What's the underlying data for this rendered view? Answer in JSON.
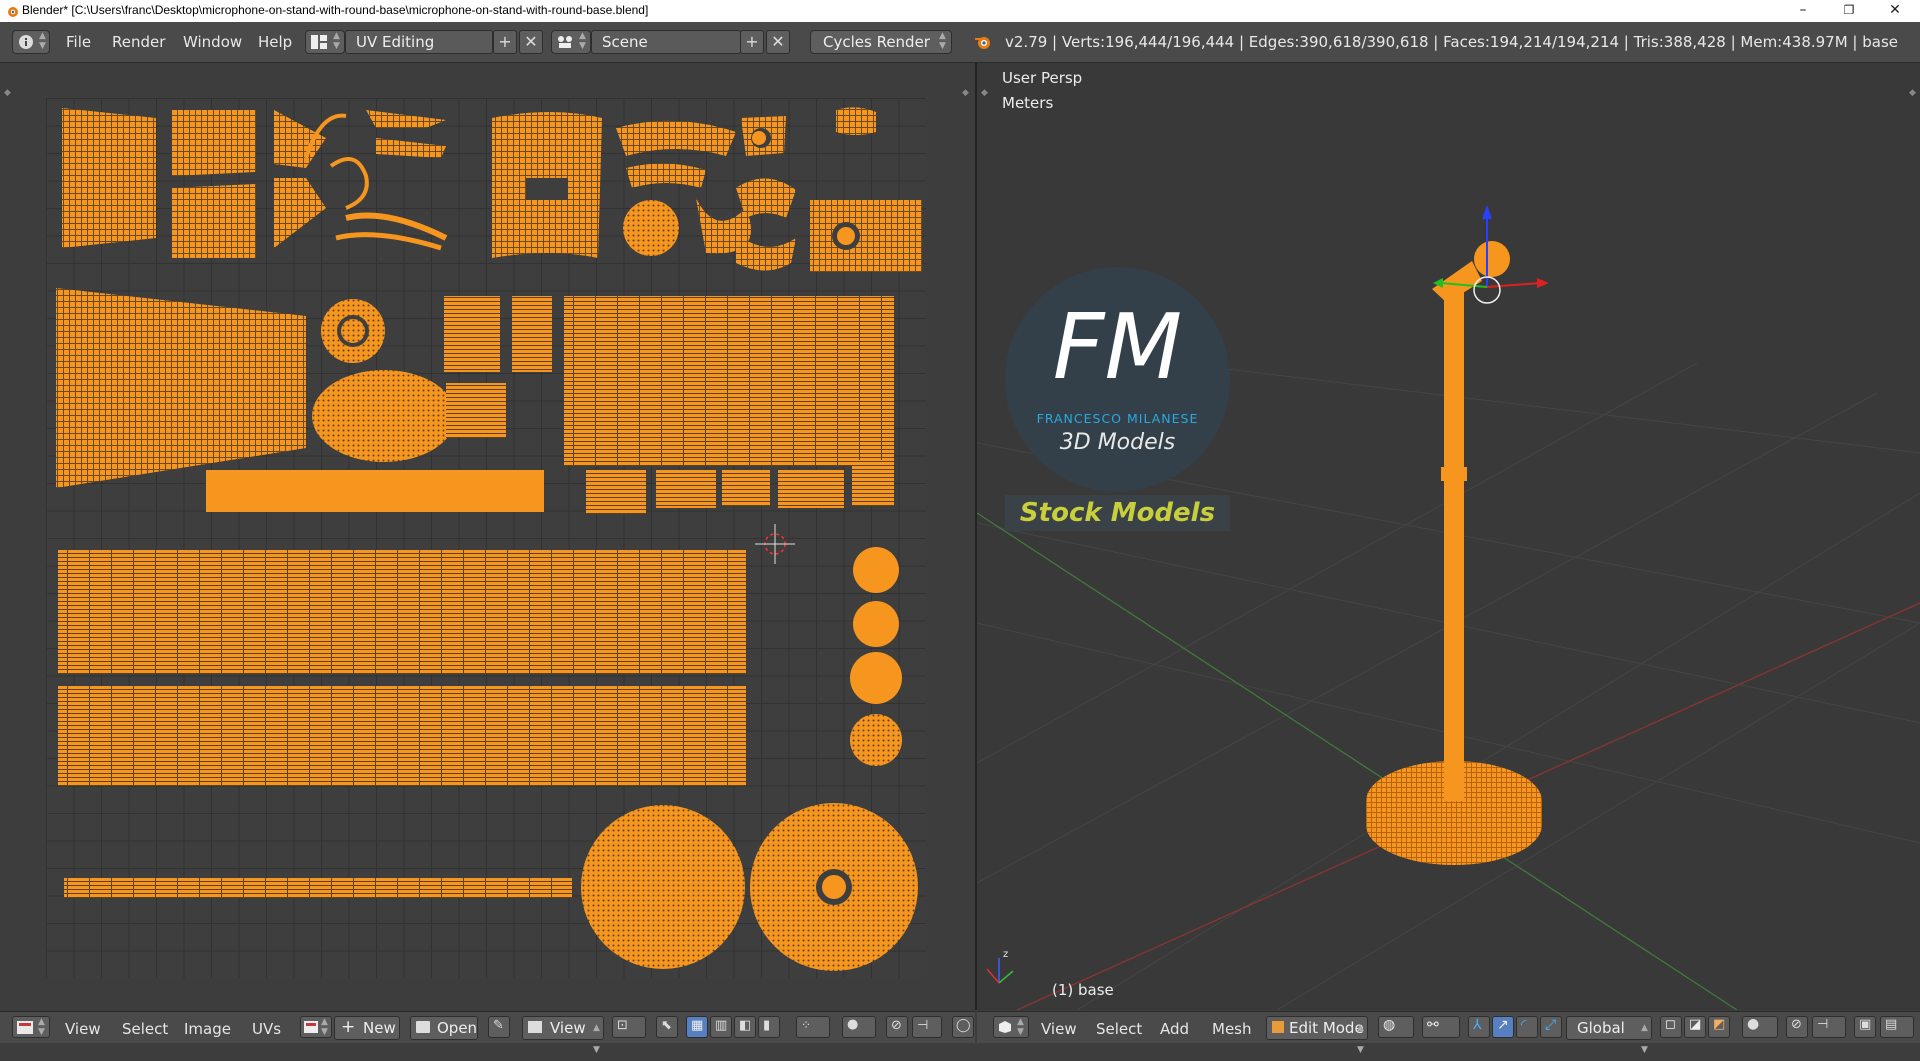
{
  "window": {
    "title": "Blender* [C:\\Users\\franc\\Desktop\\microphone-on-stand-with-round-base\\microphone-on-stand-with-round-base.blend]",
    "minimize": "–",
    "maximize": "❐",
    "close": "✕"
  },
  "info_header": {
    "menus": [
      "File",
      "Render",
      "Window",
      "Help"
    ],
    "screen_layout": "UV Editing",
    "scene": "Scene",
    "render_engine": "Cycles Render",
    "stats": "v2.79 | Verts:196,444/196,444 | Edges:390,618/390,618 | Faces:194,214/194,214 | Tris:388,428 | Mem:438.97M | base"
  },
  "viewport": {
    "view_name": "User Persp",
    "units": "Meters",
    "object_label": "(1) base"
  },
  "logo": {
    "letters": "FM",
    "name": "FRANCESCO MILANESE",
    "subtitle": "3D Models",
    "banner": "Stock Models"
  },
  "uv_footer": {
    "menus": [
      "View",
      "Select",
      "Image",
      "UVs"
    ],
    "new_label": "New",
    "open_label": "Open",
    "view_label": "View"
  },
  "v3d_footer": {
    "menus": [
      "View",
      "Select",
      "Add",
      "Mesh"
    ],
    "mode": "Edit Mode",
    "orientation": "Global"
  },
  "colors": {
    "uv_orange": "#f7961e",
    "header_bg": "#4a4a4a",
    "grid_bg": "#3e3e3e",
    "logo_blue": "#29a9e1",
    "banner_yellow": "#c8cf3c"
  }
}
